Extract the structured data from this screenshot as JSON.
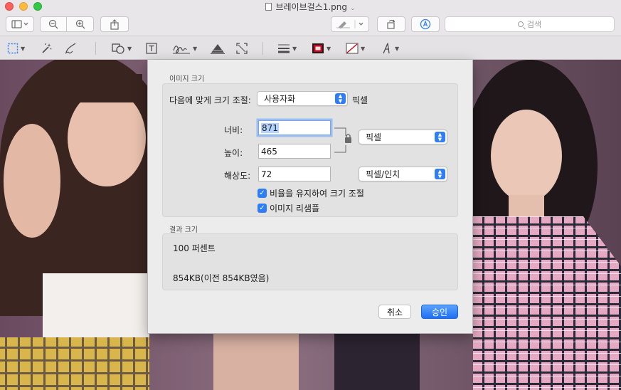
{
  "window": {
    "title": "브레이브걸스1.png"
  },
  "toolbar": {
    "search_placeholder": "검색"
  },
  "dialog": {
    "image_size_group": "이미지 크기",
    "fit_label": "다음에 맞게 크기 조절:",
    "fit_value": "사용자화",
    "fit_unit": "픽셀",
    "width_label": "너비:",
    "width_value": "871",
    "height_label": "높이:",
    "height_value": "465",
    "size_unit": "픽셀",
    "resolution_label": "해상도:",
    "resolution_value": "72",
    "resolution_unit": "픽셀/인치",
    "keep_ratio_label": "비율을 유지하여 크기 조절",
    "resample_label": "이미지 리샘플",
    "result_group": "결과 크기",
    "result_percent": "100 퍼센트",
    "result_size": "854KB(이전 854KB였음)",
    "cancel_label": "취소",
    "ok_label": "승인"
  },
  "colors": {
    "accent": "#2f7ef6"
  }
}
